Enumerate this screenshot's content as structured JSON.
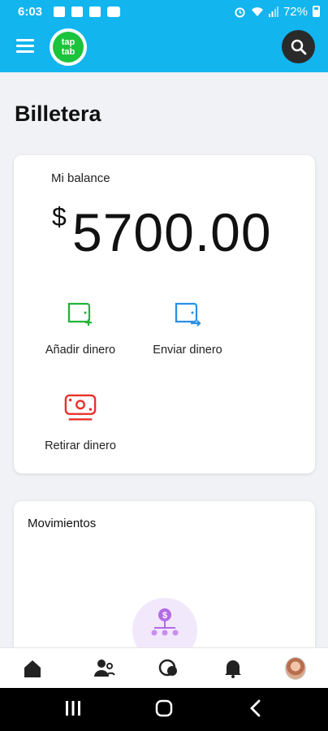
{
  "status_bar": {
    "time": "6:03",
    "battery": "72%"
  },
  "app_bar": {
    "logo_text_top": "tap",
    "logo_text_bottom": "tab"
  },
  "page": {
    "title": "Billetera"
  },
  "balance": {
    "label": "Mi balance",
    "currency": "$",
    "amount": "5700.00"
  },
  "actions": [
    {
      "label": "Añadir dinero",
      "icon": "wallet-add-icon",
      "color": "#22b33a"
    },
    {
      "label": "Enviar dinero",
      "icon": "wallet-send-icon",
      "color": "#2a8fe6"
    },
    {
      "label": "Retirar dinero",
      "icon": "cash-withdraw-icon",
      "color": "#e8312a"
    }
  ],
  "movements": {
    "title": "Movimientos"
  },
  "bottom_nav": [
    {
      "icon": "home-icon"
    },
    {
      "icon": "friends-icon"
    },
    {
      "icon": "chat-icon"
    },
    {
      "icon": "bell-icon"
    },
    {
      "icon": "avatar"
    }
  ],
  "colors": {
    "primary": "#12b5ee",
    "background": "#f1f2f6"
  }
}
